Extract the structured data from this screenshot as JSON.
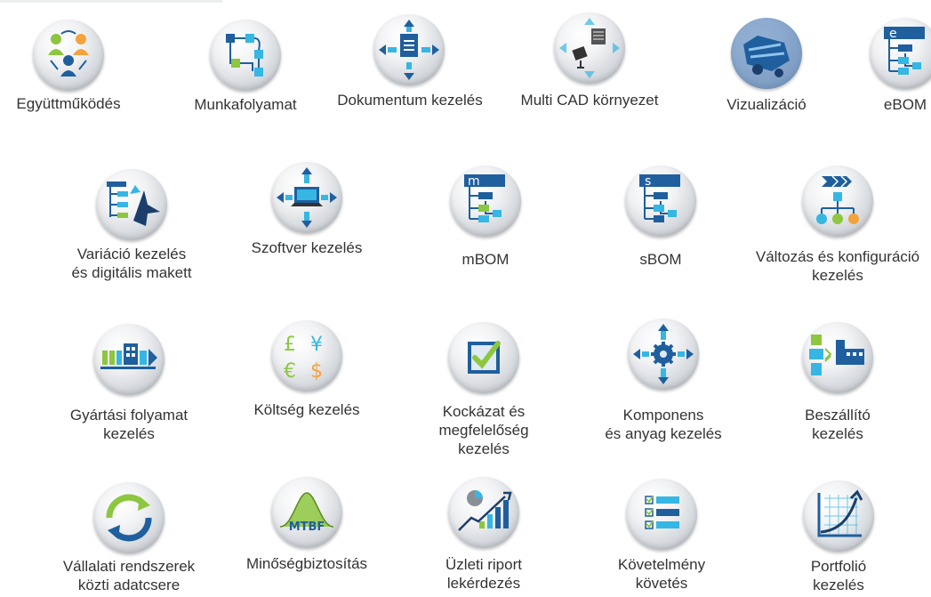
{
  "colors": {
    "blue": "#1f5f9e",
    "cyan": "#36b6e3",
    "green": "#8dc63f",
    "orange": "#f4a23c",
    "text": "#333333"
  },
  "items": [
    {
      "id": "egyuttmukodes",
      "icon": "collaboration-icon",
      "lines": [
        "Együttműködés"
      ]
    },
    {
      "id": "munkafolyamat",
      "icon": "workflow-icon",
      "lines": [
        "Munkafolyamat"
      ]
    },
    {
      "id": "dokumentum",
      "icon": "document-management-icon",
      "lines": [
        "Dokumentum kezelés"
      ]
    },
    {
      "id": "multicad",
      "icon": "multi-cad-icon",
      "lines": [
        "Multi CAD környezet"
      ]
    },
    {
      "id": "vizualizacio",
      "icon": "visualization-icon",
      "lines": [
        "Vizualizáció"
      ]
    },
    {
      "id": "ebom",
      "icon": "ebom-icon",
      "lines": [
        "eBOM"
      ],
      "letter": "e"
    },
    {
      "id": "variacio",
      "icon": "variation-mockup-icon",
      "lines": [
        "Variáció kezelés",
        "és digitális makett"
      ]
    },
    {
      "id": "szoftver",
      "icon": "software-management-icon",
      "lines": [
        "Szoftver kezelés"
      ]
    },
    {
      "id": "mbom",
      "icon": "mbom-icon",
      "lines": [
        "mBOM"
      ],
      "letter": "m"
    },
    {
      "id": "sbom",
      "icon": "sbom-icon",
      "lines": [
        "sBOM"
      ],
      "letter": "s"
    },
    {
      "id": "valtozas",
      "icon": "change-configuration-icon",
      "lines": [
        "Változás és konfiguráció",
        "kezelés"
      ]
    },
    {
      "id": "gyartasi",
      "icon": "manufacturing-process-icon",
      "lines": [
        "Gyártási folyamat",
        "kezelés"
      ]
    },
    {
      "id": "koltseg",
      "icon": "cost-management-icon",
      "lines": [
        "Költség kezelés"
      ],
      "currency": [
        "£",
        "¥",
        "€",
        "$"
      ]
    },
    {
      "id": "kockazat",
      "icon": "risk-compliance-icon",
      "lines": [
        "Kockázat és",
        "megfelelőség",
        "kezelés"
      ]
    },
    {
      "id": "komponens",
      "icon": "component-material-icon",
      "lines": [
        "Komponens",
        "és anyag kezelés"
      ]
    },
    {
      "id": "beszallito",
      "icon": "supplier-management-icon",
      "lines": [
        "Beszállító",
        "kezelés"
      ]
    },
    {
      "id": "vallalati",
      "icon": "enterprise-integration-icon",
      "lines": [
        "Vállalati rendszerek",
        "közti adatcsere"
      ]
    },
    {
      "id": "minoseg",
      "icon": "quality-assurance-icon",
      "lines": [
        "Minőségbiztosítás"
      ],
      "letter": "MTBF"
    },
    {
      "id": "uzleti",
      "icon": "business-report-icon",
      "lines": [
        "Üzleti riport",
        "lekérdezés"
      ]
    },
    {
      "id": "kovetelmeny",
      "icon": "requirements-tracking-icon",
      "lines": [
        "Követelmény",
        "követés"
      ]
    },
    {
      "id": "portfolio",
      "icon": "portfolio-management-icon",
      "lines": [
        "Portfolió",
        "kezelés"
      ]
    }
  ]
}
